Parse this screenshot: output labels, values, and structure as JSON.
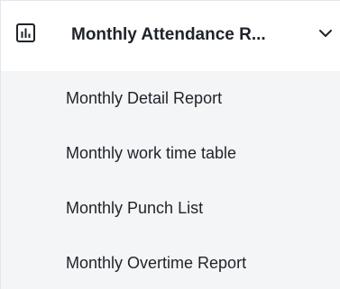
{
  "menu": {
    "title": "Monthly Attendance R...",
    "icon": "bar-chart-icon",
    "expand_icon": "chevron-down-icon",
    "items": [
      {
        "label": "Monthly Detail Report"
      },
      {
        "label": "Monthly work time table"
      },
      {
        "label": "Monthly Punch List"
      },
      {
        "label": "Monthly Overtime Report"
      }
    ]
  },
  "colors": {
    "text": "#1f2329",
    "submenu_background": "#f3f5f7",
    "border": "#e3e7ec"
  }
}
